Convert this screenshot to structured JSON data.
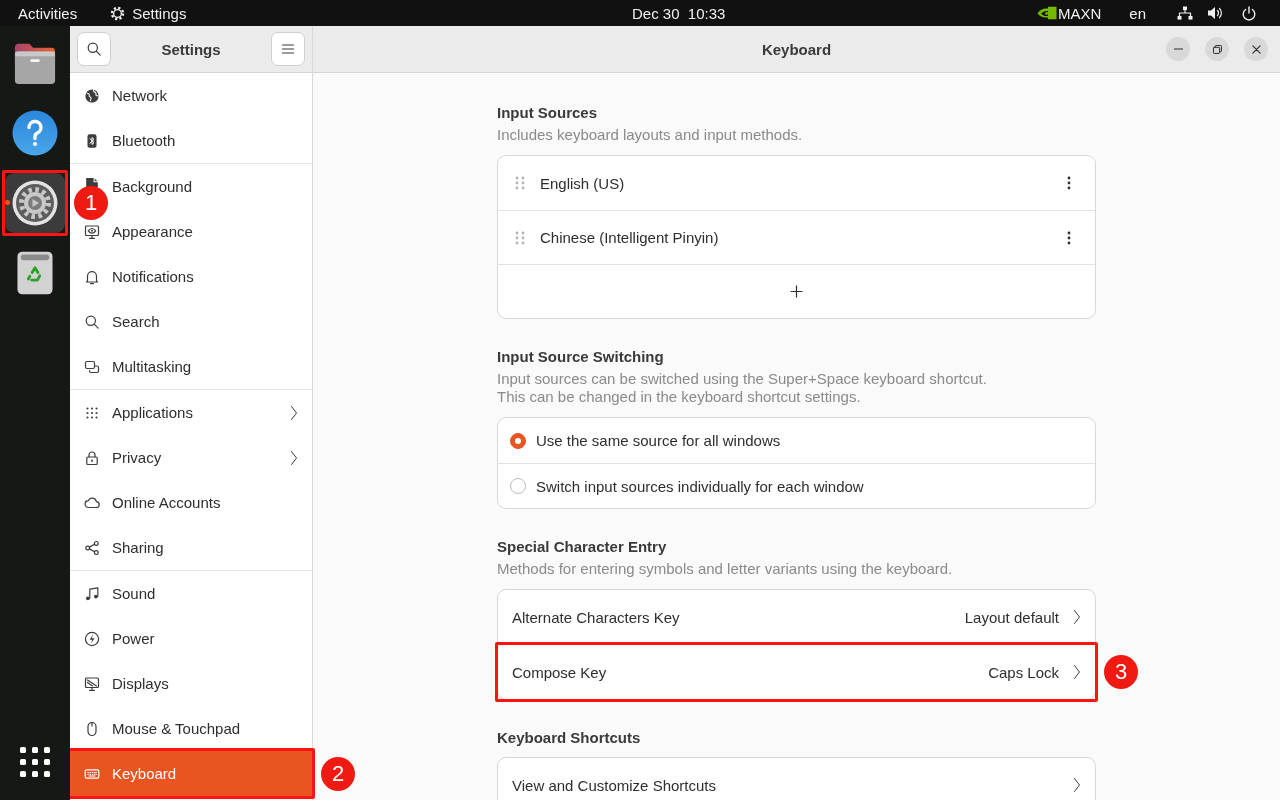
{
  "top_bar": {
    "activities": "Activities",
    "app_menu": "Settings",
    "clock": "Dec 30  10:33",
    "power_mode": "MAXN",
    "keyboard_layout": "en"
  },
  "dock": {
    "items": [
      {
        "kind": "files",
        "focused": false,
        "running": false
      },
      {
        "kind": "help",
        "focused": false,
        "running": false
      },
      {
        "kind": "settings",
        "focused": true,
        "running": true,
        "annotation": "1"
      },
      {
        "kind": "trash",
        "focused": false,
        "running": false
      }
    ]
  },
  "sidebar": {
    "title": "Settings",
    "groups": [
      {
        "items": [
          {
            "kind": "network",
            "label": "Network",
            "selected": false,
            "submenu": false
          },
          {
            "kind": "bluetooth",
            "label": "Bluetooth",
            "selected": false,
            "submenu": false
          }
        ]
      },
      {
        "items": [
          {
            "kind": "background",
            "label": "Background",
            "selected": false,
            "submenu": false
          },
          {
            "kind": "appearance",
            "label": "Appearance",
            "selected": false,
            "submenu": false
          },
          {
            "kind": "notifications",
            "label": "Notifications",
            "selected": false,
            "submenu": false
          },
          {
            "kind": "search",
            "label": "Search",
            "selected": false,
            "submenu": false
          },
          {
            "kind": "multitasking",
            "label": "Multitasking",
            "selected": false,
            "submenu": false
          }
        ]
      },
      {
        "items": [
          {
            "kind": "applications",
            "label": "Applications",
            "selected": false,
            "submenu": true
          },
          {
            "kind": "privacy",
            "label": "Privacy",
            "selected": false,
            "submenu": true
          },
          {
            "kind": "online-accounts",
            "label": "Online Accounts",
            "selected": false,
            "submenu": false
          },
          {
            "kind": "sharing",
            "label": "Sharing",
            "selected": false,
            "submenu": false
          }
        ]
      },
      {
        "items": [
          {
            "kind": "sound",
            "label": "Sound",
            "selected": false,
            "submenu": false
          },
          {
            "kind": "power",
            "label": "Power",
            "selected": false,
            "submenu": false
          },
          {
            "kind": "displays",
            "label": "Displays",
            "selected": false,
            "submenu": false
          },
          {
            "kind": "mouse",
            "label": "Mouse & Touchpad",
            "selected": false,
            "submenu": false
          },
          {
            "kind": "keyboard",
            "label": "Keyboard",
            "selected": true,
            "submenu": false,
            "annotation": "2"
          }
        ]
      }
    ]
  },
  "page": {
    "title": "Keyboard",
    "sections": [
      {
        "title": "Input Sources",
        "description": "Includes keyboard layouts and input methods.",
        "rows": [
          {
            "kind": "source",
            "label": "English (US)"
          },
          {
            "kind": "source",
            "label": "Chinese (Intelligent Pinyin)"
          },
          {
            "kind": "add"
          }
        ]
      },
      {
        "title": "Input Source Switching",
        "description": "Input sources can be switched using the Super+Space keyboard shortcut.\nThis can be changed in the keyboard shortcut settings.",
        "rows": [
          {
            "kind": "radio",
            "label": "Use the same source for all windows",
            "selected": true
          },
          {
            "kind": "radio",
            "label": "Switch input sources individually for each window",
            "selected": false
          }
        ]
      },
      {
        "title": "Special Character Entry",
        "description": "Methods for entering symbols and letter variants using the keyboard.",
        "rows": [
          {
            "kind": "link",
            "label": "Alternate Characters Key",
            "value": "Layout default"
          },
          {
            "kind": "link",
            "label": "Compose Key",
            "value": "Caps Lock",
            "annotation": "3"
          }
        ]
      },
      {
        "title": "Keyboard Shortcuts",
        "rows": [
          {
            "kind": "link",
            "label": "View and Customize Shortcuts"
          }
        ]
      }
    ]
  }
}
